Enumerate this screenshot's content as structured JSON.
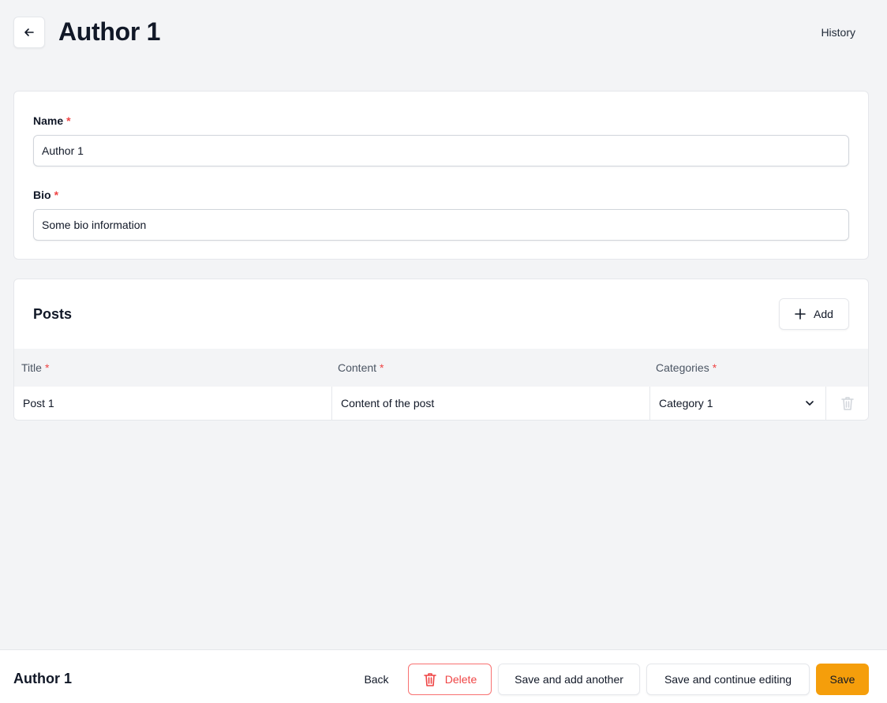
{
  "header": {
    "title": "Author 1",
    "history_label": "History"
  },
  "form": {
    "name": {
      "label": "Name",
      "required_mark": "*",
      "value": "Author 1"
    },
    "bio": {
      "label": "Bio",
      "required_mark": "*",
      "value": "Some bio information"
    }
  },
  "posts": {
    "title": "Posts",
    "add_label": "Add",
    "columns": [
      {
        "label": "Title",
        "required_mark": "*"
      },
      {
        "label": "Content",
        "required_mark": "*"
      },
      {
        "label": "Categories",
        "required_mark": "*"
      }
    ],
    "rows": [
      {
        "title": "Post 1",
        "content": "Content of the post",
        "category": "Category 1"
      }
    ]
  },
  "footer": {
    "title": "Author 1",
    "back_label": "Back",
    "delete_label": "Delete",
    "save_add_another_label": "Save and add another",
    "save_continue_label": "Save and continue editing",
    "save_label": "Save"
  },
  "colors": {
    "accent": "#f59e0b",
    "danger": "#ef4444",
    "background": "#f3f4f6"
  },
  "icons": {
    "back": "arrow-left-icon",
    "add": "plus-icon",
    "dropdown": "chevron-down-icon",
    "delete": "trash-icon"
  }
}
